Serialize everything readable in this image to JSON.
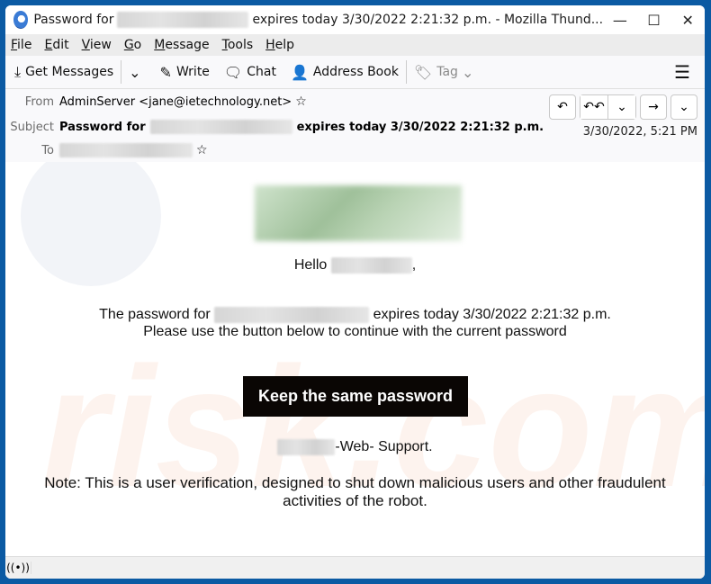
{
  "window": {
    "title_prefix": "Password for",
    "title_suffix": "expires today 3/30/2022 2:21:32 p.m. - Mozilla Thund...",
    "controls": {
      "minimize": "—",
      "maximize": "☐",
      "close": "✕"
    }
  },
  "menu": [
    "File",
    "Edit",
    "View",
    "Go",
    "Message",
    "Tools",
    "Help"
  ],
  "menu_access_keys": [
    "F",
    "E",
    "V",
    "G",
    "M",
    "T",
    "H"
  ],
  "toolbar": {
    "get_messages": "Get Messages",
    "write": "Write",
    "chat": "Chat",
    "address_book": "Address Book",
    "tag": "Tag",
    "icons": {
      "get_messages": "⤓",
      "dropdown": "⌄",
      "write": "✎",
      "chat": "🗨",
      "address_book": "👤",
      "tag": "🏷",
      "menu": "☰"
    }
  },
  "header": {
    "from_label": "From",
    "from_value": "AdminServer <jane@ietechnology.net>",
    "subject_label": "Subject",
    "subject_prefix": "Password for",
    "subject_suffix": "expires today 3/30/2022 2:21:32 p.m.",
    "to_label": "To",
    "date": "3/30/2022, 5:21 PM",
    "star": "☆",
    "buttons": {
      "reply": "↶",
      "reply_all": "↶↶",
      "reply_all_menu": "⌄",
      "forward": "→",
      "more": "⌄"
    }
  },
  "email": {
    "hello": "Hello",
    "hello_comma": ",",
    "line1_prefix": "The password for",
    "line1_suffix": "expires today 3/30/2022 2:21:32 p.m.",
    "line2": "Please use the button below to continue with the current password",
    "button": "Keep the same password",
    "signature": "-Web- Support.",
    "note": "Note: This is a user verification, designed to shut down malicious users and other fraudulent activities of the robot."
  },
  "status": {
    "icon": "((•))"
  }
}
